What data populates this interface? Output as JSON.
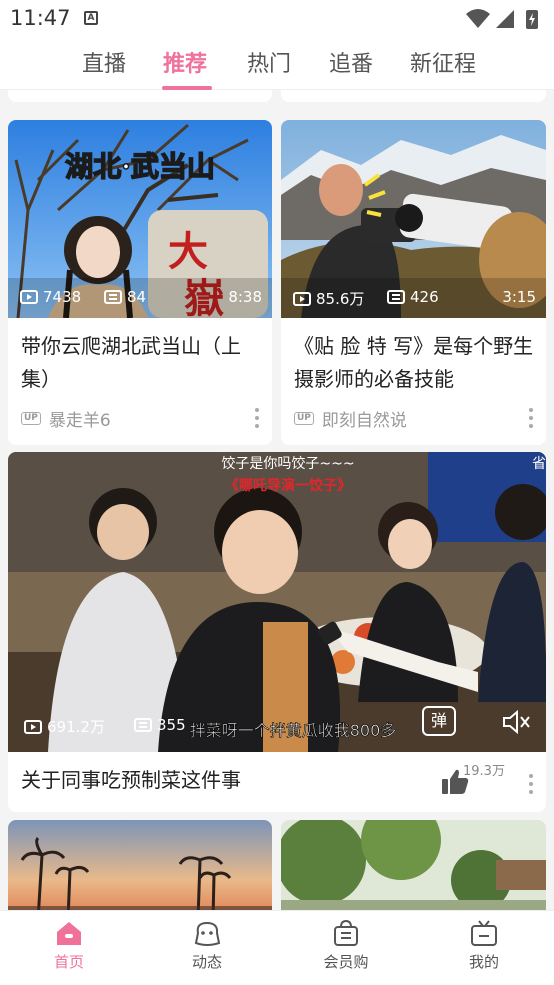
{
  "status_bar": {
    "time": "11:47",
    "notif_glyph": "A"
  },
  "top_tabs": [
    {
      "label": "直播",
      "active": false
    },
    {
      "label": "推荐",
      "active": true
    },
    {
      "label": "热门",
      "active": false
    },
    {
      "label": "追番",
      "active": false
    },
    {
      "label": "新征程",
      "active": false
    }
  ],
  "accent_color": "#f0729a",
  "feed": [
    {
      "overlay_title": "湖北·武当山",
      "overlay_stone": "大",
      "overlay_stone2": "嶽",
      "views": "7438",
      "danmaku": "84",
      "duration": "8:38",
      "title": "带你云爬湖北武当山（上集）",
      "author": "暴走羊6"
    },
    {
      "views": "85.6万",
      "danmaku": "426",
      "duration": "3:15",
      "title": "《贴 脸 特 写》是每个野生摄影师的必备技能",
      "author": "即刻自然说"
    },
    {
      "overlay_caption_top": "饺子是你吗饺子~~~",
      "overlay_caption_red": "《哪吒导演一饺子》",
      "overlay_caption_bottom": "拌菜呀一个拌黄瓜收我800多",
      "overlay_corner": "省",
      "views": "691.2万",
      "danmaku": "355",
      "danmaku_button": "弹",
      "title": "关于同事吃预制菜这件事",
      "likes": "19.3万"
    }
  ],
  "bottom_nav": [
    {
      "label": "首页",
      "icon": "home-icon",
      "active": true
    },
    {
      "label": "动态",
      "icon": "dynamic-icon",
      "active": false
    },
    {
      "label": "会员购",
      "icon": "shop-icon",
      "active": false
    },
    {
      "label": "我的",
      "icon": "tv-icon",
      "active": false
    }
  ]
}
